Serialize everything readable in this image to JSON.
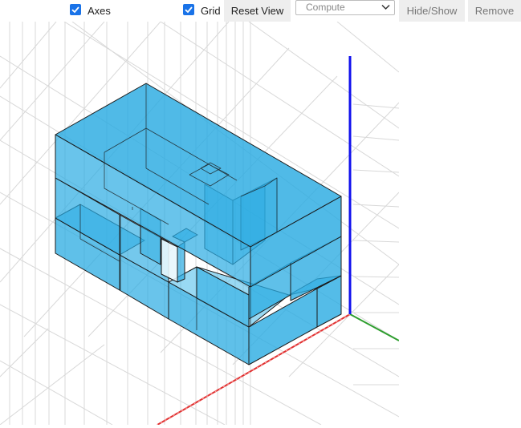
{
  "toolbar": {
    "axes_label": "Axes",
    "axes_checked": true,
    "grid_label": "Grid",
    "grid_checked": true,
    "reset_view_label": "Reset View",
    "compute_placeholder": "Compute",
    "hide_show_label": "Hide/Show",
    "remove_label": "Remove"
  },
  "viewport": {
    "background_color": "#ffffff",
    "grid_color": "#d8d8d8",
    "box_fill_color": "#29abe2",
    "edge_color": "#1b1b1b",
    "axis_x_color": "#e03030",
    "axis_y_color": "#2e9e2e",
    "axis_z_color": "#1010ee"
  }
}
